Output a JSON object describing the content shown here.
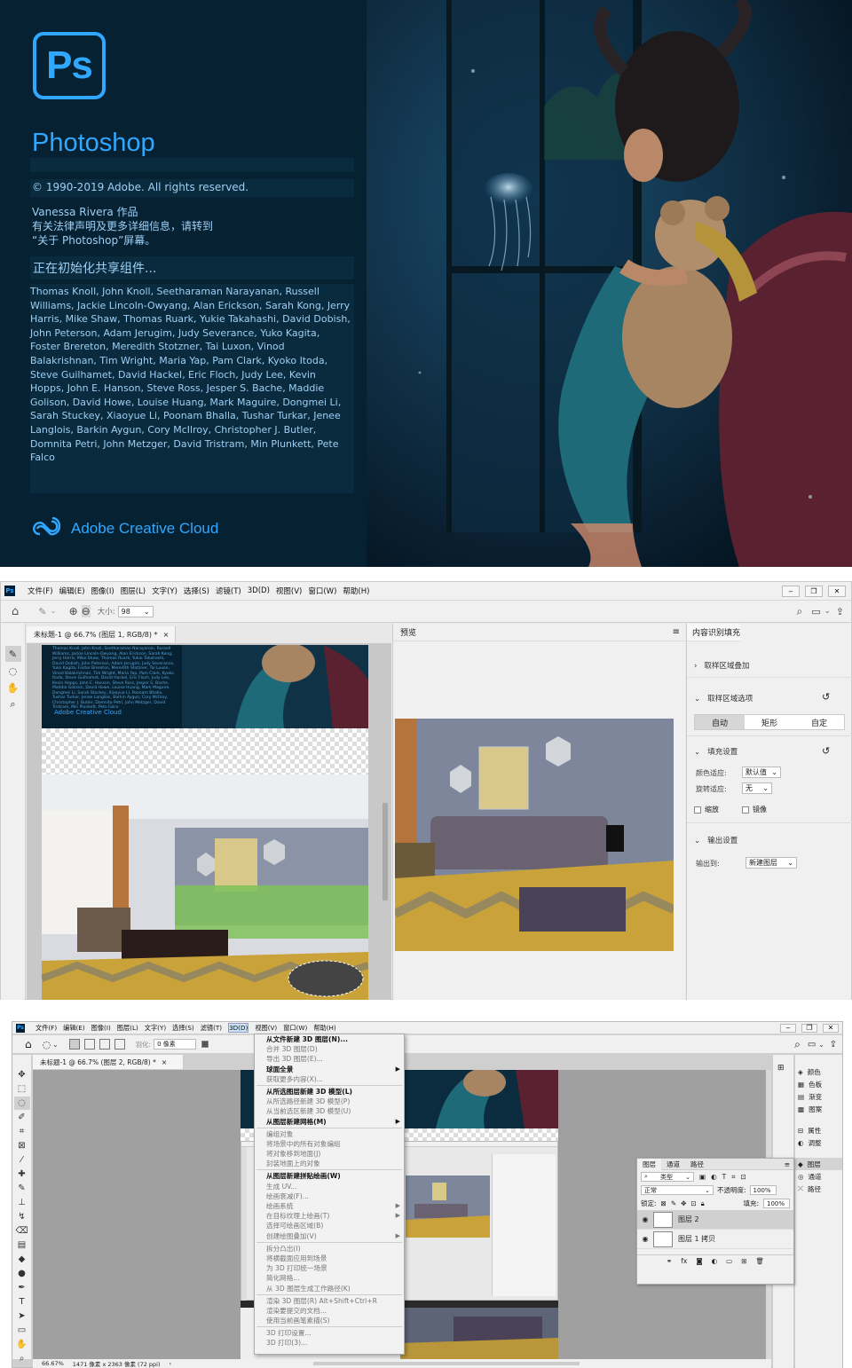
{
  "splash": {
    "logo_text": "Ps",
    "app_name": "Photoshop",
    "copyright": "© 1990-2019 Adobe. All rights reserved.",
    "artwork_lines": [
      "Vanessa Rivera 作品",
      "有关法律声明及更多详细信息，请转到",
      "“关于 Photoshop”屏幕。"
    ],
    "init_status": "正在初始化共享组件...",
    "credits": "Thomas Knoll, John Knoll, Seetharaman Narayanan, Russell Williams, Jackie Lincoln-Owyang, Alan Erickson, Sarah Kong, Jerry Harris, Mike Shaw, Thomas Ruark, Yukie Takahashi, David Dobish, John Peterson, Adam Jerugim, Judy Severance, Yuko Kagita, Foster Brereton, Meredith Stotzner, Tai Luxon, Vinod Balakrishnan, Tim Wright, Maria Yap, Pam Clark, Kyoko Itoda, Steve Guilhamet, David Hackel, Eric Floch, Judy Lee, Kevin Hopps, John E. Hanson, Steve Ross, Jesper S. Bache, Maddie Golison, David Howe, Louise Huang, Mark Maguire, Dongmei Li, Sarah Stuckey, Xiaoyue Li, Poonam Bhalla, Tushar Turkar, Jenee Langlois, Barkin Aygun, Cory McIlroy, Christopher J. Butler, Domnita Petri, John Metzger, David Tristram, Min Plunkett, Pete Falco",
    "cc_text": "Adobe Creative Cloud",
    "brand_color": "#31a8ff"
  },
  "window1": {
    "app_icon": "Ps",
    "menus": [
      "文件(F)",
      "编辑(E)",
      "图像(I)",
      "图层(L)",
      "文字(Y)",
      "选择(S)",
      "滤镜(T)",
      "3D(D)",
      "视图(V)",
      "窗口(W)",
      "帮助(H)"
    ],
    "size_label": "大小:",
    "size_value": "98",
    "doc_tab": "未标题-1 @ 66.7% (图层 1, RGB/8) *",
    "doc_tab_close": "×",
    "mini_cc_text": "Adobe Creative Cloud",
    "preview_title": "预览",
    "panel_title": "内容识别填充",
    "sec_sampling_overlay": "取样区域叠加",
    "sec_sampling_options": "取样区域选项",
    "sample_buttons": [
      "自动",
      "矩形",
      "自定"
    ],
    "sec_fill": "填充设置",
    "color_adapt_label": "颜色适应:",
    "color_adapt_value": "默认值",
    "rotate_adapt_label": "旋转适应:",
    "rotate_adapt_value": "无",
    "scale_label": "缩放",
    "mirror_label": "镜像",
    "sec_output": "输出设置",
    "output_to_label": "输出到:",
    "output_to_value": "新建图层"
  },
  "window2": {
    "menus": [
      "文件(F)",
      "编辑(E)",
      "图像(I)",
      "图层(L)",
      "文字(Y)",
      "选择(S)",
      "滤镜(T)",
      "3D(D)",
      "视图(V)",
      "窗口(W)",
      "帮助(H)"
    ],
    "feather_label": "羽化:",
    "feather_value": "0 像素",
    "doc_tab": "未标题-1 @ 66.7% (图层 2, RGB/8) *",
    "doc_tab_close": "×",
    "status_zoom": "66.67%",
    "status_info": "1471 像素 x 2363 像素 (72 ppi)",
    "menu_3d": [
      {
        "t": "从文件新建 3D 图层(N)...",
        "s": "bold"
      },
      {
        "t": "合并 3D 图层(D)",
        "s": "dim"
      },
      {
        "t": "导出 3D 图层(E)...",
        "s": "dim"
      },
      {
        "t": "球面全景",
        "s": "bold",
        "arrow": true
      },
      {
        "t": "获取更多内容(X)...",
        "s": "dim"
      },
      {
        "sep": true
      },
      {
        "t": "从所选图层新建 3D 模型(L)",
        "s": "bold"
      },
      {
        "t": "从所选路径新建 3D 模型(P)",
        "s": "dim"
      },
      {
        "t": "从当前选区新建 3D 模型(U)",
        "s": "dim"
      },
      {
        "t": "从图层新建网格(M)",
        "s": "bold",
        "arrow": true
      },
      {
        "sep": true
      },
      {
        "t": "编组对象",
        "s": "dim"
      },
      {
        "t": "将场景中的所有对象编组",
        "s": "dim"
      },
      {
        "t": "将对象移到地面(J)",
        "s": "dim"
      },
      {
        "t": "封装地面上的对象",
        "s": "dim"
      },
      {
        "sep": true
      },
      {
        "t": "从图层新建拼贴绘画(W)",
        "s": "bold"
      },
      {
        "t": "生成 UV...",
        "s": "dim"
      },
      {
        "t": "绘画衰减(F)...",
        "s": "dim"
      },
      {
        "t": "绘画系统",
        "s": "dim",
        "arrow": true
      },
      {
        "t": "在目标纹理上绘画(T)",
        "s": "dim",
        "arrow": true
      },
      {
        "t": "选择可绘画区域(B)",
        "s": "dim"
      },
      {
        "t": "创建绘图叠加(V)",
        "s": "dim",
        "arrow": true
      },
      {
        "sep": true
      },
      {
        "t": "拆分凸出(I)",
        "s": "dim"
      },
      {
        "t": "将横截面应用到场景",
        "s": "dim"
      },
      {
        "t": "为 3D 打印统一场景",
        "s": "dim"
      },
      {
        "t": "简化网格...",
        "s": "dim"
      },
      {
        "t": "从 3D 图层生成工作路径(K)",
        "s": "dim"
      },
      {
        "sep": true
      },
      {
        "t": "渲染 3D 图层(R)     Alt+Shift+Ctrl+R",
        "s": "dim"
      },
      {
        "t": "渲染要提交的文档...",
        "s": "dim"
      },
      {
        "t": "使用当前画笔素描(S)",
        "s": "dim"
      },
      {
        "sep": true
      },
      {
        "t": "3D 打印设置...",
        "s": "dim"
      },
      {
        "t": "3D 打印(3)...",
        "s": "dim"
      }
    ],
    "layers_tabs": [
      "图层",
      "通道",
      "路径"
    ],
    "layers_kind": "类型",
    "blend_mode": "正常",
    "opacity_label": "不透明度:",
    "opacity_value": "100%",
    "lock_label": "锁定:",
    "fill_label": "填充:",
    "fill_value": "100%",
    "layers": [
      "图层 2",
      "图层 1 拷贝"
    ],
    "side_panels_top": [
      "颜色",
      "色板",
      "渐变",
      "图案"
    ],
    "side_panels_mid": [
      "属性",
      "调整"
    ],
    "side_panels_bottom": [
      "图层",
      "通道",
      "路径"
    ]
  }
}
